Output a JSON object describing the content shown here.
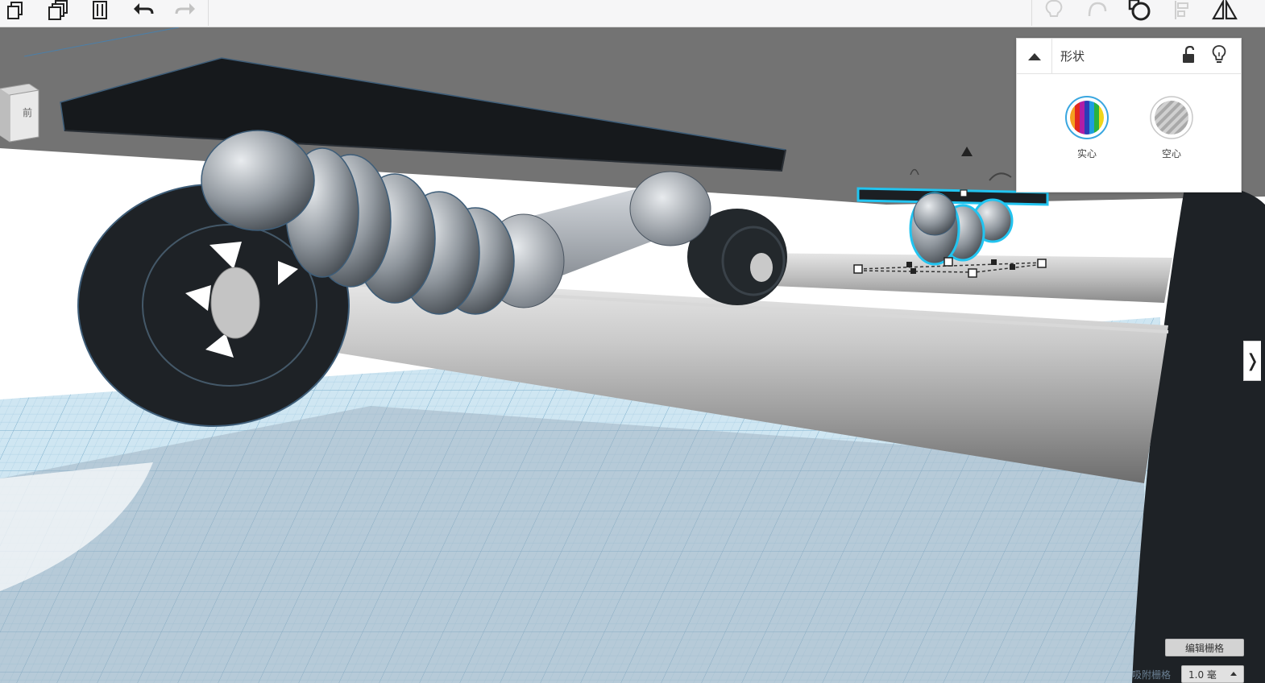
{
  "toolbar": {
    "left_buttons": [
      {
        "name": "copy",
        "icon": "copy-icon"
      },
      {
        "name": "duplicate",
        "icon": "duplicate-icon"
      },
      {
        "name": "delete",
        "icon": "trash-icon"
      },
      {
        "name": "undo",
        "icon": "undo-icon"
      },
      {
        "name": "redo",
        "icon": "redo-icon"
      }
    ],
    "right_buttons": [
      {
        "name": "notes",
        "icon": "lightbulb-icon"
      },
      {
        "name": "group",
        "icon": "group-icon"
      },
      {
        "name": "ungroup",
        "icon": "ungroup-icon"
      },
      {
        "name": "align",
        "icon": "align-icon"
      },
      {
        "name": "mirror",
        "icon": "mirror-icon"
      }
    ]
  },
  "viewcube": {
    "face_label": "前"
  },
  "shape_panel": {
    "title": "形状",
    "solid_label": "实心",
    "hole_label": "空心",
    "icons": [
      "collapse-up-icon",
      "unlock-icon",
      "lightbulb-icon"
    ]
  },
  "right_tab": {
    "glyph": "❭"
  },
  "bottom_controls": {
    "edit_grid_label": "编辑栅格",
    "snap_label": "吸附栅格",
    "snap_value": "1.0 毫"
  },
  "colors": {
    "selection_outline": "#22c4f0",
    "grid_blue": "#a8cfe6",
    "shape_dark": "#1e2226",
    "shape_gray": "#b8b8b8",
    "toolbar_bg": "#f6f6f7"
  }
}
